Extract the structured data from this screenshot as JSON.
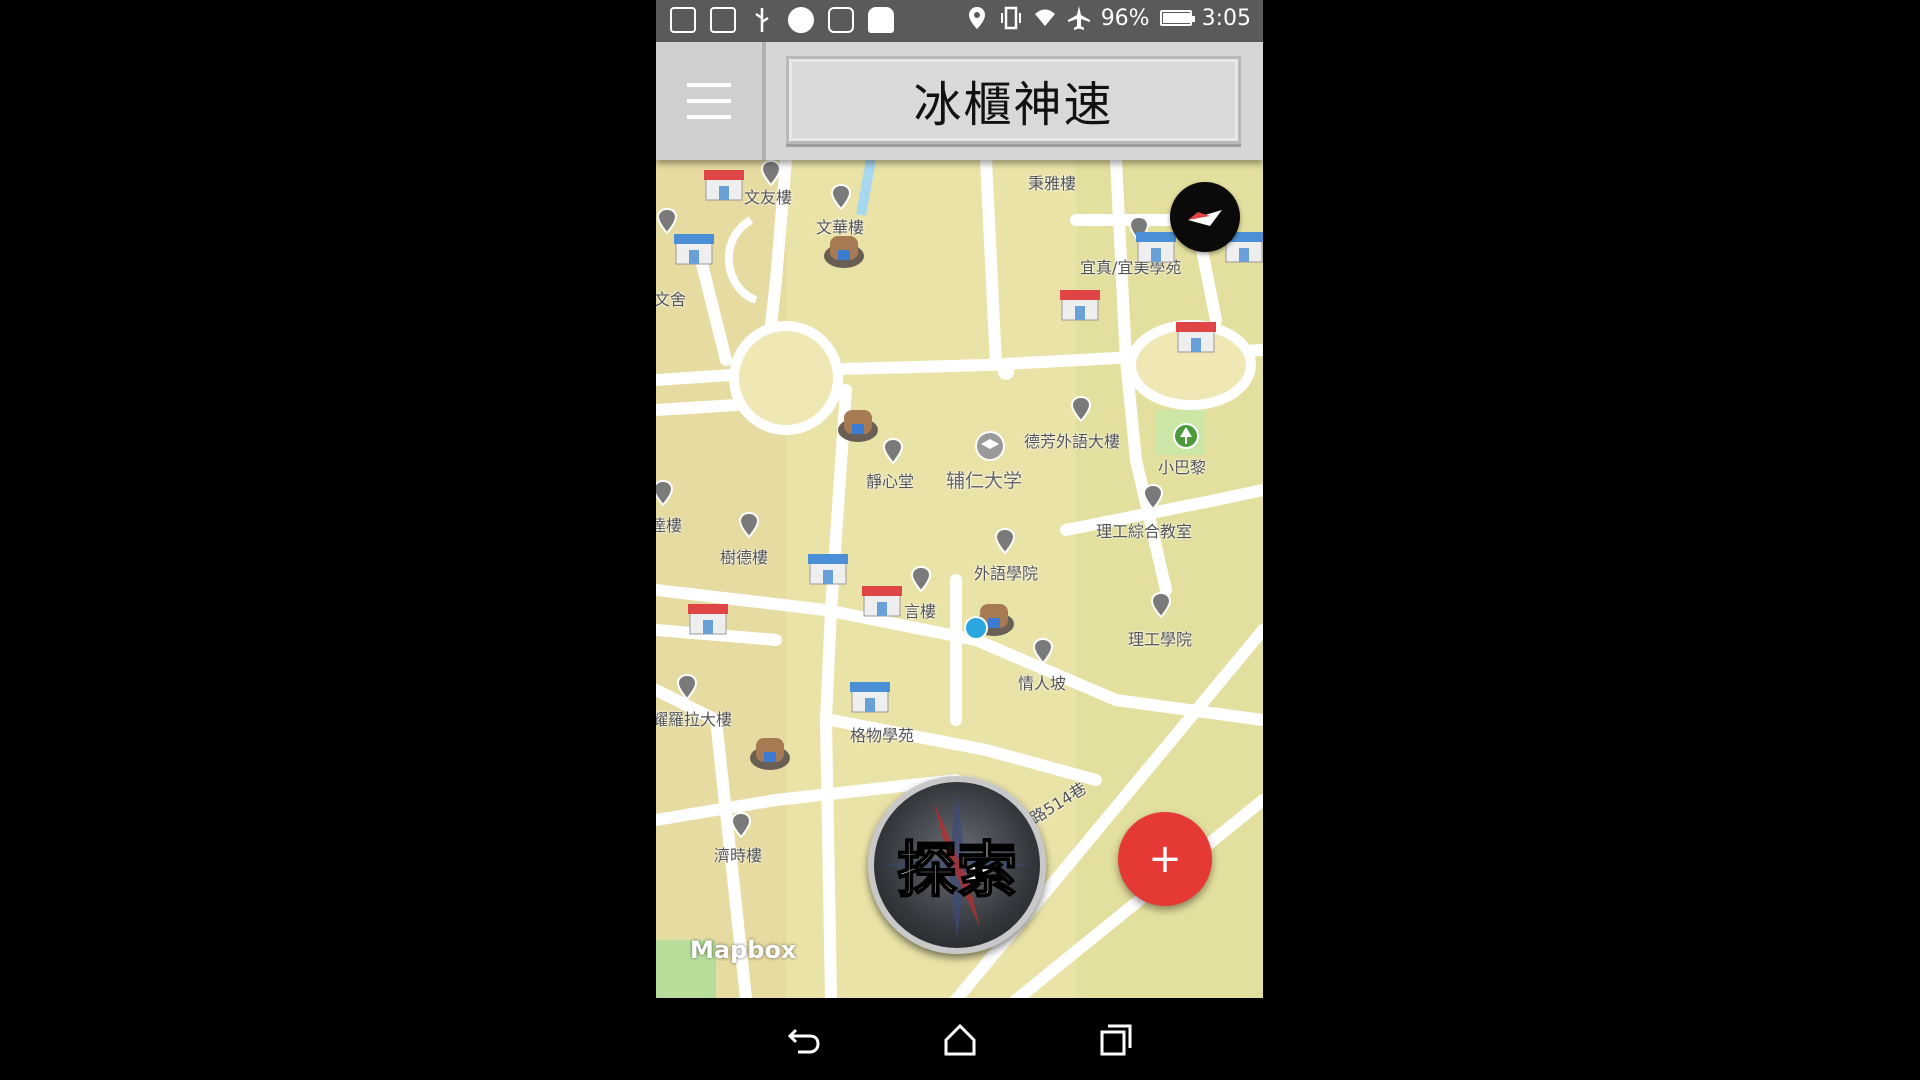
{
  "status_bar": {
    "battery": "96%",
    "battery_level": 0.96,
    "time": "3:05",
    "left_icons": [
      "code-icon",
      "code-icon",
      "usb-icon",
      "messenger-icon",
      "instagram-icon",
      "android-icon"
    ],
    "right_icons": [
      "location-icon",
      "vibrate-icon",
      "wifi-icon",
      "airplane-icon",
      "battery-icon"
    ]
  },
  "header": {
    "title": "冰櫃神速",
    "menu_icon": "hamburger-icon"
  },
  "map": {
    "attribution": "Mapbox",
    "labels": [
      {
        "key": "wenyou",
        "text": "文友樓"
      },
      {
        "key": "wenhua",
        "text": "文華樓"
      },
      {
        "key": "bingya",
        "text": "秉雅樓"
      },
      {
        "key": "yizhen",
        "text": "宜真/宜美學苑"
      },
      {
        "key": "wenshe",
        "text": "文舍"
      },
      {
        "key": "defang",
        "text": "德芳外語大樓"
      },
      {
        "key": "xiaobali",
        "text": "小巴黎"
      },
      {
        "key": "jingxin",
        "text": "靜心堂"
      },
      {
        "key": "furen",
        "text": "辅仁大学"
      },
      {
        "key": "ligong_zonghe",
        "text": "理工綜合教室"
      },
      {
        "key": "tatu",
        "text": "達樓"
      },
      {
        "key": "shude",
        "text": "樹德樓"
      },
      {
        "key": "waiyu",
        "text": "外語學院"
      },
      {
        "key": "yan",
        "text": "言樓"
      },
      {
        "key": "ligong",
        "text": "理工學院"
      },
      {
        "key": "qingren",
        "text": "情人坡"
      },
      {
        "key": "yaoluola",
        "text": "耀羅拉大樓"
      },
      {
        "key": "gewu",
        "text": "格物學苑"
      },
      {
        "key": "road",
        "text": "路514巷"
      },
      {
        "key": "jishi",
        "text": "濟時樓"
      }
    ]
  },
  "explore_button": {
    "label": "探索"
  },
  "fab": {
    "label": "+"
  },
  "nav_bar": {
    "back": "back-icon",
    "home": "home-icon",
    "recents": "recents-icon"
  }
}
